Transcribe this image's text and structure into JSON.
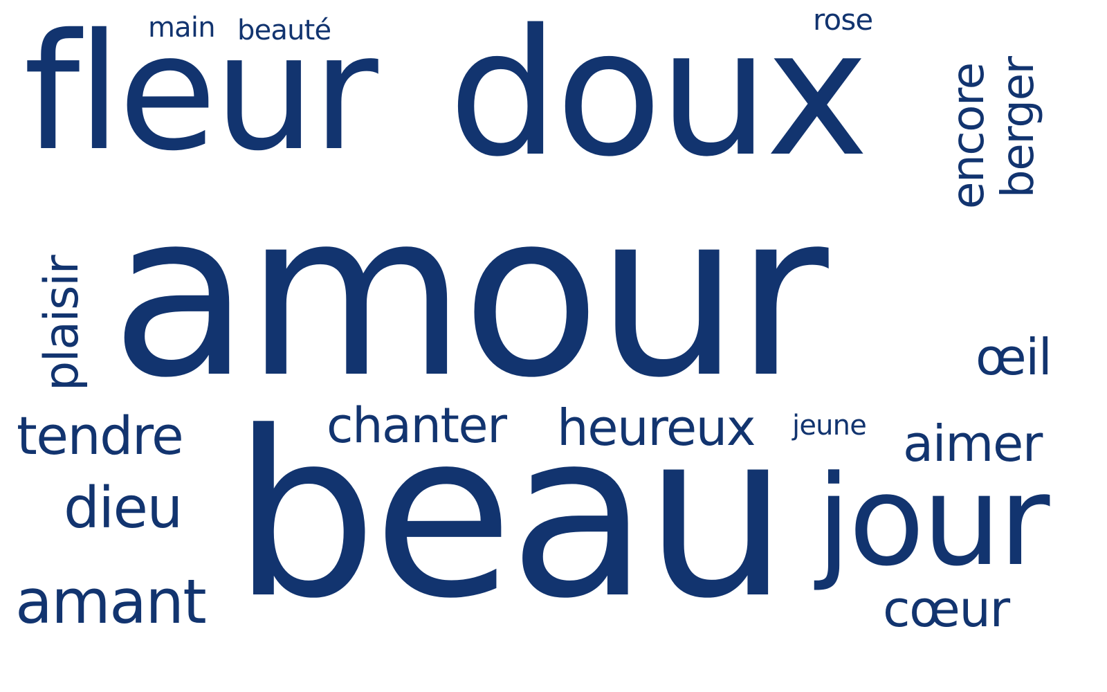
{
  "wordcloud": {
    "color": "#12346f",
    "words": {
      "fleur": "fleur",
      "doux": "doux",
      "amour": "amour",
      "beau": "beau",
      "jour": "jour",
      "main": "main",
      "beaute": "beauté",
      "rose": "rose",
      "encore": "encore",
      "berger": "berger",
      "plaisir": "plaisir",
      "oeil": "œil",
      "tendre": "tendre",
      "chanter": "chanter",
      "heureux": "heureux",
      "jeune": "jeune",
      "aimer": "aimer",
      "dieu": "dieu",
      "amant": "amant",
      "coeur": "cœur"
    }
  }
}
